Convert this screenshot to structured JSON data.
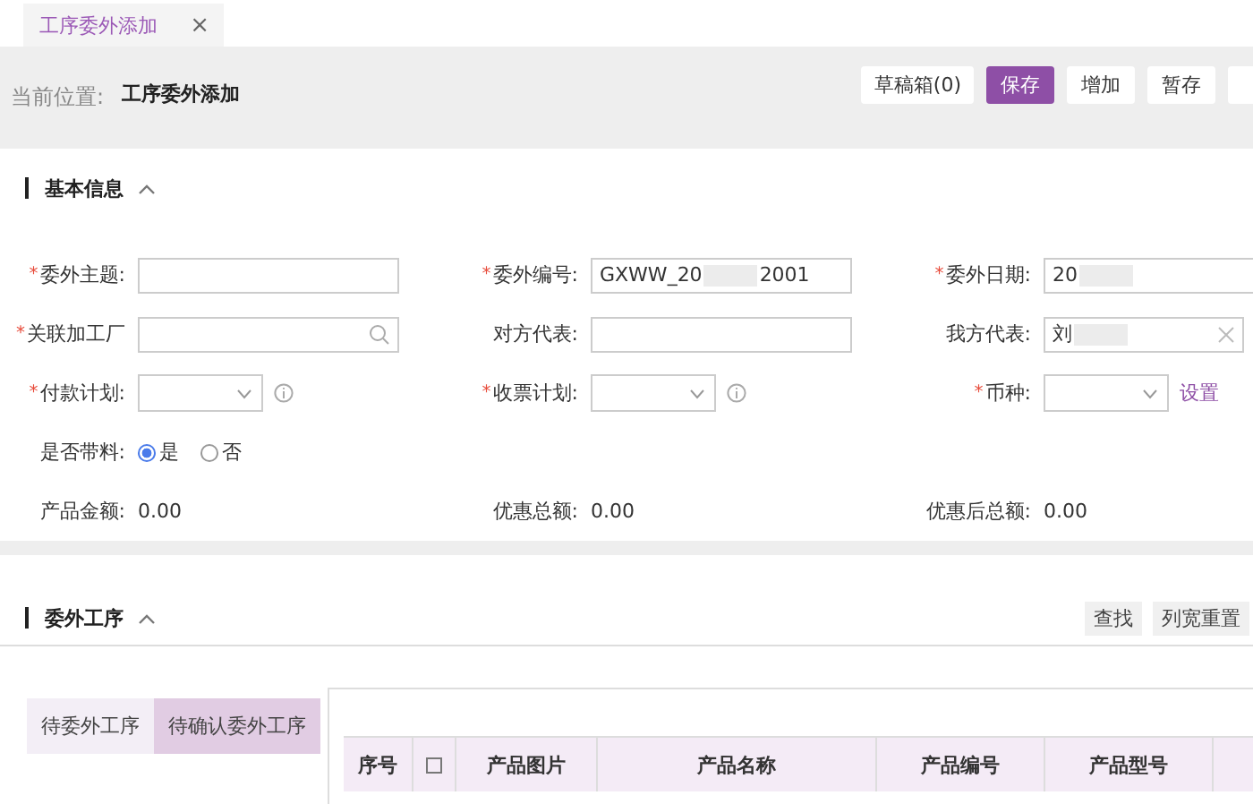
{
  "tabs": [
    {
      "label": "工序委外添加",
      "selected": true,
      "close": "×"
    }
  ],
  "breadcrumb": {
    "label": "当前位置:",
    "current": "工序委外添加"
  },
  "toolbar_buttons": [
    {
      "label": "草稿箱(0)",
      "primary": false
    },
    {
      "label": "保存",
      "primary": true
    },
    {
      "label": "增加",
      "primary": false
    },
    {
      "label": "暂存",
      "primary": false
    },
    {
      "primary": false
    }
  ],
  "basic_section": {
    "title": "基本信息",
    "expanded": true,
    "rows": [
      [
        {
          "label": "委外主题:",
          "mark": "*",
          "kind": "text"
        },
        {
          "label": "委外编号:",
          "mark": "*",
          "kind": "text",
          "value": "GXWW_20",
          "value_end": "2001",
          "blurred": true
        },
        {
          "label": "委外日期:",
          "mark": "*",
          "kind": "text",
          "value": "20",
          "blurred": true
        }
      ],
      [
        {
          "label": "关联加工厂",
          "mark": "*",
          "kind": "search"
        },
        {
          "label": "对方代表:",
          "kind": "text"
        },
        {
          "label": "我方代表:",
          "kind": "clearable",
          "value": "刘",
          "blurred": true
        }
      ],
      [
        {
          "label": "付款计划:",
          "mark": "*",
          "kind": "select",
          "info": true
        },
        {
          "label": "收票计划:",
          "mark": "*",
          "kind": "select",
          "info": true
        },
        {
          "label": "币种:",
          "mark": "*",
          "kind": "select",
          "link": "设置"
        }
      ],
      [
        {
          "label": "是否带料:",
          "kind": "radio",
          "options": [
            {
              "label": "是",
              "selected": true
            },
            {
              "label": "否",
              "selected": false
            }
          ]
        }
      ],
      [
        {
          "label": "产品金额:",
          "kind": "amount",
          "value": "0.00"
        },
        {
          "label": "优惠总额:",
          "kind": "amount",
          "value": "0.00"
        },
        {
          "label": "优惠后总额:",
          "kind": "amount",
          "value": "0.00"
        }
      ]
    ]
  },
  "process_section": {
    "title": "委外工序",
    "expanded": true,
    "buttons": [
      "查找",
      "列宽重置"
    ],
    "subtabs": [
      {
        "label": "待委外工序",
        "selected": false
      },
      {
        "label": "待确认委外工序",
        "selected": true
      }
    ],
    "table": {
      "columns": [
        {
          "label": "序号",
          "kind": "text"
        },
        {
          "kind": "checkbox",
          "checked": false
        },
        {
          "label": "产品图片",
          "kind": "text"
        },
        {
          "label": "产品名称",
          "kind": "text"
        },
        {
          "label": "产品编号",
          "kind": "text"
        },
        {
          "label": "产品型号",
          "kind": "text"
        }
      ]
    }
  }
}
